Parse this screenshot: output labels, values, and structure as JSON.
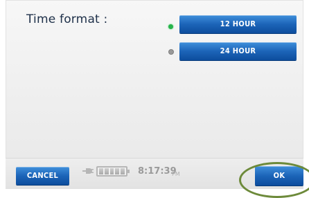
{
  "settings": {
    "label": "Time format :",
    "options": [
      {
        "label": "12 HOUR",
        "selected": true
      },
      {
        "label": "24 HOUR",
        "selected": false
      }
    ]
  },
  "footer": {
    "cancel_label": "CANCEL",
    "ok_label": "OK",
    "time": "8:17:39",
    "period": "PM",
    "battery_icon": "battery-icon",
    "power_icon": "plug-icon"
  },
  "colors": {
    "button": "#1c64b8",
    "selected_indicator": "#27b34b",
    "unselected_indicator": "#9a9a9a",
    "highlight_ring": "#6d8a3a"
  }
}
